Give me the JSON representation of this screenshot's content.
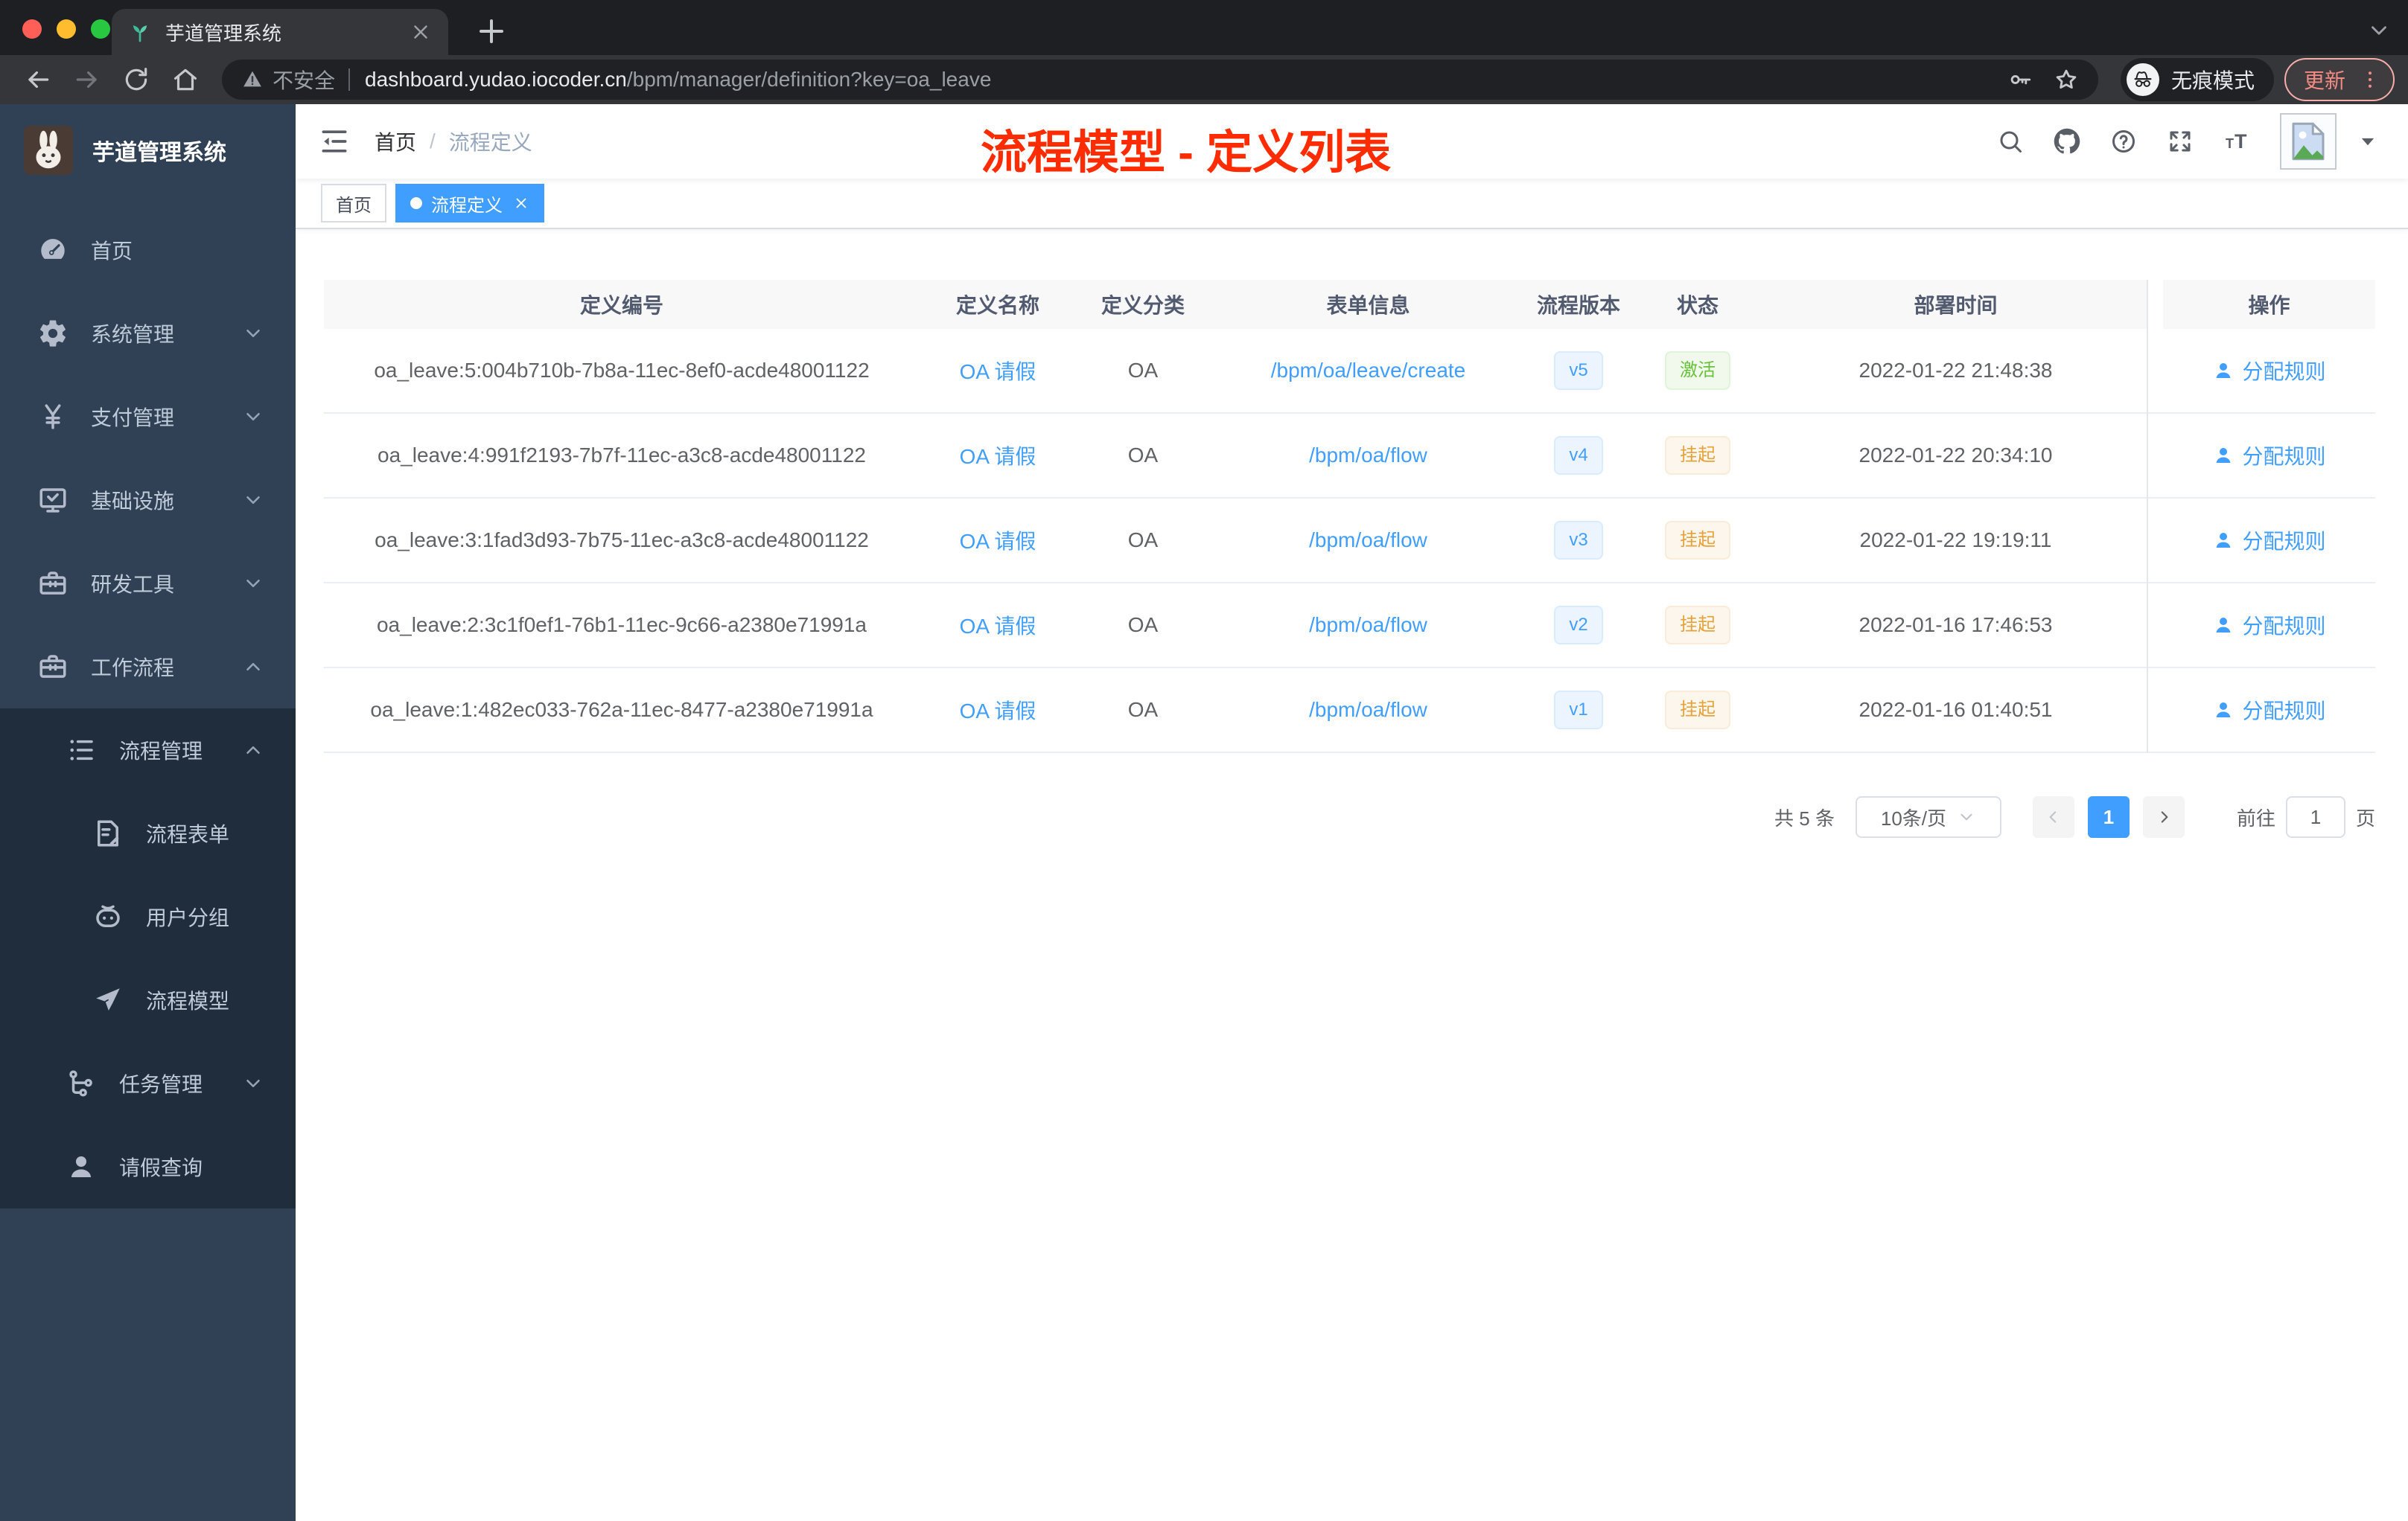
{
  "chrome": {
    "tab_title": "芋道管理系统",
    "security_label": "不安全",
    "url_host": "dashboard.yudao.iocoder.cn",
    "url_path": "/bpm/manager/definition?key=oa_leave",
    "incognito_label": "无痕模式",
    "update_label": "更新"
  },
  "sidebar": {
    "app_title": "芋道管理系统",
    "menu": [
      {
        "icon": "dashboard-icon",
        "label": "首页",
        "level": 1,
        "arrow": null,
        "dark": false
      },
      {
        "icon": "gear-icon",
        "label": "系统管理",
        "level": 1,
        "arrow": "down",
        "dark": false
      },
      {
        "icon": "yen-icon",
        "label": "支付管理",
        "level": 1,
        "arrow": "down",
        "dark": false
      },
      {
        "icon": "monitor-icon",
        "label": "基础设施",
        "level": 1,
        "arrow": "down",
        "dark": false
      },
      {
        "icon": "toolbox-icon",
        "label": "研发工具",
        "level": 1,
        "arrow": "down",
        "dark": false
      },
      {
        "icon": "toolbox-icon",
        "label": "工作流程",
        "level": 1,
        "arrow": "up",
        "dark": false
      },
      {
        "icon": "tree-list-icon",
        "label": "流程管理",
        "level": 2,
        "arrow": "up",
        "dark": true
      },
      {
        "icon": "form-icon",
        "label": "流程表单",
        "level": 3,
        "arrow": null,
        "dark": true
      },
      {
        "icon": "robot-icon",
        "label": "用户分组",
        "level": 3,
        "arrow": null,
        "dark": true
      },
      {
        "icon": "send-icon",
        "label": "流程模型",
        "level": 3,
        "arrow": null,
        "dark": true
      },
      {
        "icon": "flow-icon",
        "label": "任务管理",
        "level": 2,
        "arrow": "down",
        "dark": true
      },
      {
        "icon": "user-icon",
        "label": "请假查询",
        "level": 2,
        "arrow": null,
        "dark": true
      }
    ]
  },
  "navbar": {
    "breadcrumb": [
      "首页",
      "流程定义"
    ],
    "breadcrumb_separator": "/",
    "annotation": "流程模型 - 定义列表"
  },
  "tags": [
    {
      "label": "首页",
      "active": false
    },
    {
      "label": "流程定义",
      "active": true
    }
  ],
  "table": {
    "columns": [
      "定义编号",
      "定义名称",
      "定义分类",
      "表单信息",
      "流程版本",
      "状态",
      "部署时间",
      "操作"
    ],
    "action_label": "分配规则",
    "rows": [
      {
        "id": "oa_leave:5:004b710b-7b8a-11ec-8ef0-acde48001122",
        "name": "OA 请假",
        "category": "OA",
        "form": "/bpm/oa/leave/create",
        "version": "v5",
        "status": "激活",
        "status_type": "success",
        "deploy_time": "2022-01-22 21:48:38"
      },
      {
        "id": "oa_leave:4:991f2193-7b7f-11ec-a3c8-acde48001122",
        "name": "OA 请假",
        "category": "OA",
        "form": "/bpm/oa/flow",
        "version": "v4",
        "status": "挂起",
        "status_type": "warning",
        "deploy_time": "2022-01-22 20:34:10"
      },
      {
        "id": "oa_leave:3:1fad3d93-7b75-11ec-a3c8-acde48001122",
        "name": "OA 请假",
        "category": "OA",
        "form": "/bpm/oa/flow",
        "version": "v3",
        "status": "挂起",
        "status_type": "warning",
        "deploy_time": "2022-01-22 19:19:11"
      },
      {
        "id": "oa_leave:2:3c1f0ef1-76b1-11ec-9c66-a2380e71991a",
        "name": "OA 请假",
        "category": "OA",
        "form": "/bpm/oa/flow",
        "version": "v2",
        "status": "挂起",
        "status_type": "warning",
        "deploy_time": "2022-01-16 17:46:53"
      },
      {
        "id": "oa_leave:1:482ec033-762a-11ec-8477-a2380e71991a",
        "name": "OA 请假",
        "category": "OA",
        "form": "/bpm/oa/flow",
        "version": "v1",
        "status": "挂起",
        "status_type": "warning",
        "deploy_time": "2022-01-16 01:40:51"
      }
    ]
  },
  "pagination": {
    "total": "共 5 条",
    "page_size": "10条/页",
    "current_page": "1",
    "goto": "前往",
    "goto_value": "1",
    "unit": "页"
  },
  "colors": {
    "accent": "#409eff",
    "sidebar_bg": "#304156",
    "submenu_bg": "#1f2d3d",
    "annotation_red": "#fe2c00",
    "success": "#67c23a",
    "warning": "#e6a23c",
    "traffic_red": "#ff5f57",
    "traffic_yellow": "#febc2e",
    "traffic_green": "#28c840"
  }
}
